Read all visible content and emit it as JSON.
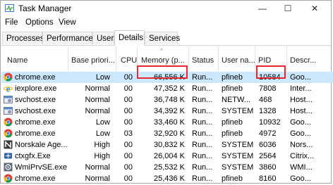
{
  "window": {
    "title": "Task Manager",
    "minimize": "—",
    "maximize": "☐",
    "close": "✕"
  },
  "menu": [
    "File",
    "Options",
    "View"
  ],
  "tabs": [
    "Processes",
    "Performance",
    "Users",
    "Details",
    "Services"
  ],
  "active_tab": "Details",
  "columns": [
    "Name",
    "Base priori...",
    "CPU",
    "Memory (p...",
    "Status",
    "User na...",
    "PID",
    "Descr..."
  ],
  "sort_indicator": "^",
  "rows": [
    {
      "icon": "chrome-icon",
      "name": "chrome.exe",
      "priority": "Low",
      "cpu": "00",
      "memory": "66,556 K",
      "status": "Run...",
      "user": "pfineb",
      "pid": "10584",
      "desc": "Goo...",
      "selected": true
    },
    {
      "icon": "ie-icon",
      "name": "iexplore.exe",
      "priority": "Normal",
      "cpu": "00",
      "memory": "47,352 K",
      "status": "Run...",
      "user": "pfineb",
      "pid": "7808",
      "desc": "Inter..."
    },
    {
      "icon": "svchost-icon",
      "name": "svchost.exe",
      "priority": "Normal",
      "cpu": "00",
      "memory": "36,748 K",
      "status": "Run...",
      "user": "NETW...",
      "pid": "468",
      "desc": "Host..."
    },
    {
      "icon": "svchost-icon",
      "name": "svchost.exe",
      "priority": "Normal",
      "cpu": "00",
      "memory": "34,392 K",
      "status": "Run...",
      "user": "SYSTEM",
      "pid": "1328",
      "desc": "Host..."
    },
    {
      "icon": "chrome-icon",
      "name": "chrome.exe",
      "priority": "Low",
      "cpu": "00",
      "memory": "33,460 K",
      "status": "Run...",
      "user": "pfineb",
      "pid": "10932",
      "desc": "Goo..."
    },
    {
      "icon": "chrome-icon",
      "name": "chrome.exe",
      "priority": "Low",
      "cpu": "03",
      "memory": "32,920 K",
      "status": "Run...",
      "user": "pfineb",
      "pid": "4972",
      "desc": "Goo..."
    },
    {
      "icon": "norskale-icon",
      "name": "Norskale Age...",
      "priority": "High",
      "cpu": "00",
      "memory": "30,832 K",
      "status": "Run...",
      "user": "SYSTEM",
      "pid": "6036",
      "desc": "Nors..."
    },
    {
      "icon": "citrix-icon",
      "name": "ctxgfx.Exe",
      "priority": "High",
      "cpu": "00",
      "memory": "26,004 K",
      "status": "Run...",
      "user": "SYSTEM",
      "pid": "2564",
      "desc": "Citrix..."
    },
    {
      "icon": "wmi-icon",
      "name": "WmiPrvSE.exe",
      "priority": "Normal",
      "cpu": "00",
      "memory": "25,532 K",
      "status": "Run...",
      "user": "SYSTEM",
      "pid": "3860",
      "desc": "WMI..."
    },
    {
      "icon": "chrome-icon",
      "name": "chrome.exe",
      "priority": "Normal",
      "cpu": "00",
      "memory": "25,436 K",
      "status": "Run...",
      "user": "pfineb",
      "pid": "8160",
      "desc": "Goo..."
    }
  ],
  "colors": {
    "selected_row": "#cce8ff",
    "highlight_border": "#e8272f"
  }
}
